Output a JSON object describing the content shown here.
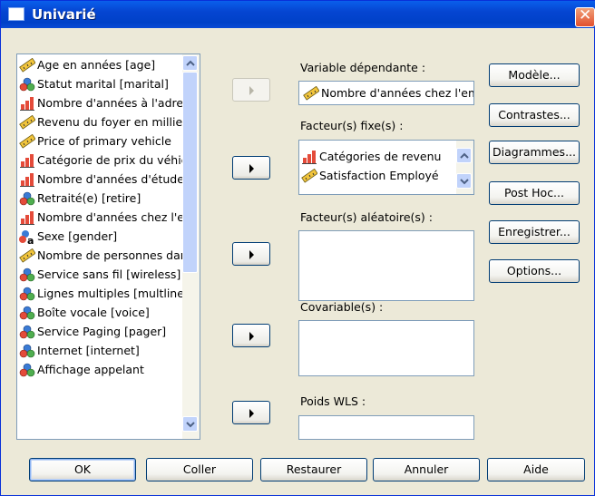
{
  "window": {
    "title": "Univarié"
  },
  "variables": [
    {
      "label": "Age en années [age]",
      "icon": "ruler"
    },
    {
      "label": "Statut marital [marital]",
      "icon": "nominal"
    },
    {
      "label": "Nombre d'années à l'adresse actuelle",
      "icon": "ordinal"
    },
    {
      "label": "Revenu du foyer en milliers",
      "icon": "ruler"
    },
    {
      "label": "Price of primary vehicle",
      "icon": "ruler"
    },
    {
      "label": "Catégorie de prix du véhicule",
      "icon": "ordinal"
    },
    {
      "label": "Nombre d'années d'études",
      "icon": "ordinal"
    },
    {
      "label": "Retraité(e) [retire]",
      "icon": "nominal"
    },
    {
      "label": "Nombre d'années chez l'employeur",
      "icon": "ordinal"
    },
    {
      "label": "Sexe [gender]",
      "icon": "nominal-string"
    },
    {
      "label": "Nombre de personnes dans le foyer",
      "icon": "ruler"
    },
    {
      "label": "Service sans fil [wireless]",
      "icon": "nominal"
    },
    {
      "label": "Lignes multiples [multline]",
      "icon": "nominal"
    },
    {
      "label": "Boîte vocale [voice]",
      "icon": "nominal"
    },
    {
      "label": "Service Paging [pager]",
      "icon": "nominal"
    },
    {
      "label": "Internet [internet]",
      "icon": "nominal"
    },
    {
      "label": "Affichage appelant",
      "icon": "nominal"
    }
  ],
  "dependent": {
    "label": "Variable dépendante :",
    "value": "Nombre d'années chez l'employeur",
    "icon": "ruler"
  },
  "fixed": {
    "label": "Facteur(s) fixe(s) :",
    "items": [
      {
        "label": "Catégories de revenu",
        "icon": "ordinal"
      },
      {
        "label": "Satisfaction Employé",
        "icon": "ruler"
      }
    ]
  },
  "random": {
    "label": "Facteur(s) aléatoire(s) :"
  },
  "covariates": {
    "label": "Covariable(s) :"
  },
  "wls": {
    "label": "Poids WLS :"
  },
  "side_buttons": {
    "model": "Modèle...",
    "contrasts": "Contrastes...",
    "plots": "Diagrammes...",
    "posthoc": "Post Hoc...",
    "save": "Enregistrer...",
    "options": "Options..."
  },
  "bottom_buttons": {
    "ok": "OK",
    "paste": "Coller",
    "reset": "Restaurer",
    "cancel": "Annuler",
    "help": "Aide"
  }
}
